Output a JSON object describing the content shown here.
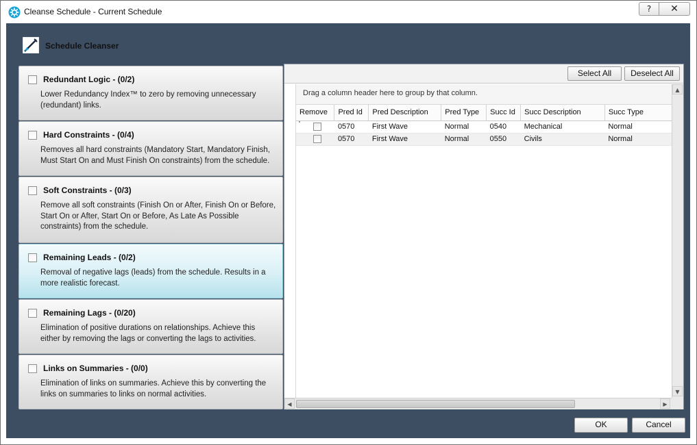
{
  "window": {
    "title": "Cleanse Schedule - Current Schedule",
    "help_label": "?",
    "close_label": "✕"
  },
  "header": {
    "title": "Schedule Cleanser"
  },
  "rules": [
    {
      "title": "Redundant Logic - (0/2)",
      "description": "Lower Redundancy Index™ to zero by removing unnecessary (redundant) links.",
      "checked": false
    },
    {
      "title": "Hard Constraints - (0/4)",
      "description": "Removes all hard constraints (Mandatory Start, Mandatory Finish, Must Start On and Must Finish On constraints) from the schedule.",
      "checked": false
    },
    {
      "title": "Soft Constraints - (0/3)",
      "description": "Remove all soft constraints (Finish On or After, Finish On or Before, Start On or After, Start On or Before, As Late As Possible constraints) from the schedule.",
      "checked": false
    },
    {
      "title": "Remaining Leads - (0/2)",
      "description": "Removal of negative lags (leads) from the schedule. Results in a more realistic forecast.",
      "checked": false,
      "selected": true
    },
    {
      "title": "Remaining Lags - (0/20)",
      "description": "Elimination of positive durations on relationships. Achieve this either by removing the lags or converting the lags to activities.",
      "checked": false
    },
    {
      "title": "Links on Summaries - (0/0)",
      "description": "Elimination of links on summaries. Achieve this by converting the links on summaries to links on normal activities.",
      "checked": false
    }
  ],
  "toolbar": {
    "select_all": "Select All",
    "deselect_all": "Deselect All"
  },
  "grid": {
    "group_hint": "Drag a column header here to group by that column.",
    "columns": [
      "Remove",
      "Pred Id",
      "Pred Description",
      "Pred Type",
      "Succ Id",
      "Succ Description",
      "Succ Type"
    ],
    "rows": [
      {
        "remove": false,
        "pred_id": "0570",
        "pred_desc": "First Wave",
        "pred_type": "Normal",
        "succ_id": "0540",
        "succ_desc": "Mechanical",
        "succ_type": "Normal"
      },
      {
        "remove": false,
        "pred_id": "0570",
        "pred_desc": "First Wave",
        "pred_type": "Normal",
        "succ_id": "0550",
        "succ_desc": "Civils",
        "succ_type": "Normal"
      }
    ]
  },
  "footer": {
    "ok": "OK",
    "cancel": "Cancel"
  },
  "colors": {
    "client_bg": "#3d4e63",
    "selected_rule": "#b6e2ec"
  }
}
